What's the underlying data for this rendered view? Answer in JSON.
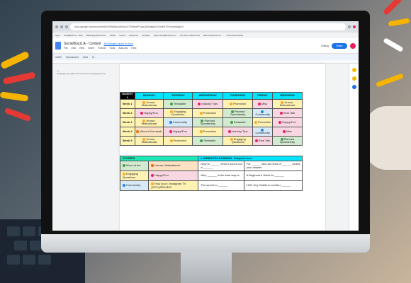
{
  "browser": {
    "url": "docs.google.com/document/d/1NWMacSdrKwzZi7SNfrwdPLwpQIMtzfgk3lGXmI8ETEHo/edit#gid=0",
    "bookmarks": [
      "Apps",
      "SocialBuzzLA - Mail",
      "Marketing Resources",
      "SLMG",
      "Canva",
      "Facebook",
      "HubSpot",
      "https://socialbuzzla.com",
      "Pro Micro Influencers",
      "Best Practices for I...",
      "Other Bookmarks"
    ]
  },
  "doc": {
    "title": "SocialBuzzLA - Content",
    "menu": [
      "File",
      "Edit",
      "View",
      "Insert",
      "Format",
      "Tools",
      "Add-ons",
      "Help"
    ],
    "last_edit": "All changes saved in Drive",
    "share_label": "Share",
    "editing_label": "Editing",
    "toolbar": [
      "100%",
      "Normal text",
      "Arial",
      "11"
    ],
    "outline_hint": "Headings you add to the document will appear here."
  },
  "calendar": {
    "headers": [
      "MONTH 1",
      "MONDAY",
      "TUESDAY",
      "WEDNESDAY",
      "THURSDAY",
      "FRIDAY",
      "WEEKEND"
    ],
    "rows": [
      {
        "week": "Week 1",
        "cells": [
          "Humor, Motivational",
          "Relatable",
          "Industry Tips",
          "Promotion",
          "Misc",
          "Humor, Motivational"
        ]
      },
      {
        "week": "Week 2",
        "cells": [
          "Happy/Fun",
          "Engaging Questions",
          "Promotion",
          "Planned Spontaneity",
          "Community",
          "Real Talk"
        ]
      },
      {
        "week": "Week 3",
        "cells": [
          "Humor, Motivational",
          "Community",
          "Planned Spontaneity",
          "Relatable",
          "Promotion",
          "Happy/Fun"
        ]
      },
      {
        "week": "Week 4",
        "cells": [
          "Word of the week",
          "Happy/Fun",
          "Promotion",
          "Industry Tips",
          "Community",
          "Misc"
        ]
      },
      {
        "week": "Week 5",
        "cells": [
          "Humor, Motivational",
          "Promotion",
          "Relatable",
          "Engaging Questions",
          "Real Talk",
          "Planned Spontaneity"
        ]
      }
    ]
  },
  "stories": {
    "header_left": "STORIES",
    "header_right": "L-WEBSITE/LEARNING: Subject Lines",
    "rows": [
      [
        "Word of the",
        "Humor, Motivational",
        "How to ______ even if you're not a ______",
        "For ______ who are tired of ______ (Solve your answer"
      ],
      [
        "Engaging Questions",
        "Happy/Fun",
        "Why ______ is the best way to",
        "A Beginner's Guide to ______"
      ],
      [
        "Community",
        "How your / Instagram TV (IGTV)/REVIEW",
        "The secret to ______",
        "1001 Key Habits to a better ______"
      ]
    ]
  },
  "colors": {
    "header_cyan": "#00e5ff",
    "week_yellow": "#fff4b0",
    "share_blue": "#1a73e8"
  }
}
